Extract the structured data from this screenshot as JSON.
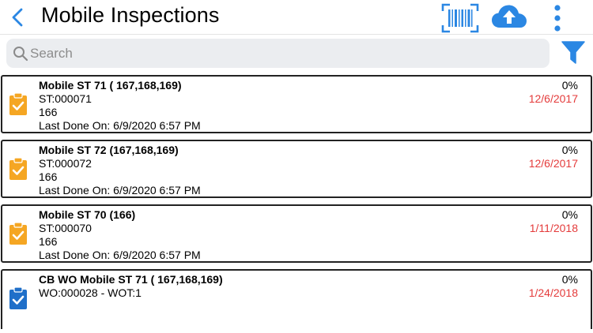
{
  "header": {
    "title": "Mobile Inspections",
    "accent_color": "#2b87e3",
    "icons": [
      "back-chevron-icon",
      "barcode-scan-icon",
      "cloud-upload-icon",
      "more-vertical-icon"
    ]
  },
  "search": {
    "placeholder": "Search",
    "value": ""
  },
  "filter_icon": "filter-icon",
  "colors": {
    "date_overdue": "#e43b3b",
    "clipboard_orange": "#f5a623",
    "clipboard_blue": "#1f6fc9"
  },
  "items": [
    {
      "name": "Mobile ST 71 ( 167,168,169)",
      "line1": "ST:000071",
      "line2": "166",
      "line3": "Last Done On: 6/9/2020 6:57 PM",
      "percent": "0%",
      "date": "12/6/2017",
      "icon": "clipboard-check-icon",
      "icon_color": "#f5a623"
    },
    {
      "name": "Mobile ST 72 (167,168,169)",
      "line1": "ST:000072",
      "line2": "166",
      "line3": "Last Done On: 6/9/2020 6:57 PM",
      "percent": "0%",
      "date": "12/6/2017",
      "icon": "clipboard-check-icon",
      "icon_color": "#f5a623"
    },
    {
      "name": "Mobile ST 70 (166)",
      "line1": "ST:000070",
      "line2": "166",
      "line3": "Last Done On: 6/9/2020 6:57 PM",
      "percent": "0%",
      "date": "1/11/2018",
      "icon": "clipboard-check-icon",
      "icon_color": "#f5a623"
    },
    {
      "name": "CB WO Mobile ST 71 ( 167,168,169)",
      "line1": "WO:000028 - WOT:1",
      "line2": "",
      "line3": "",
      "percent": "0%",
      "date": "1/24/2018",
      "icon": "clipboard-check-icon",
      "icon_color": "#1f6fc9"
    }
  ]
}
